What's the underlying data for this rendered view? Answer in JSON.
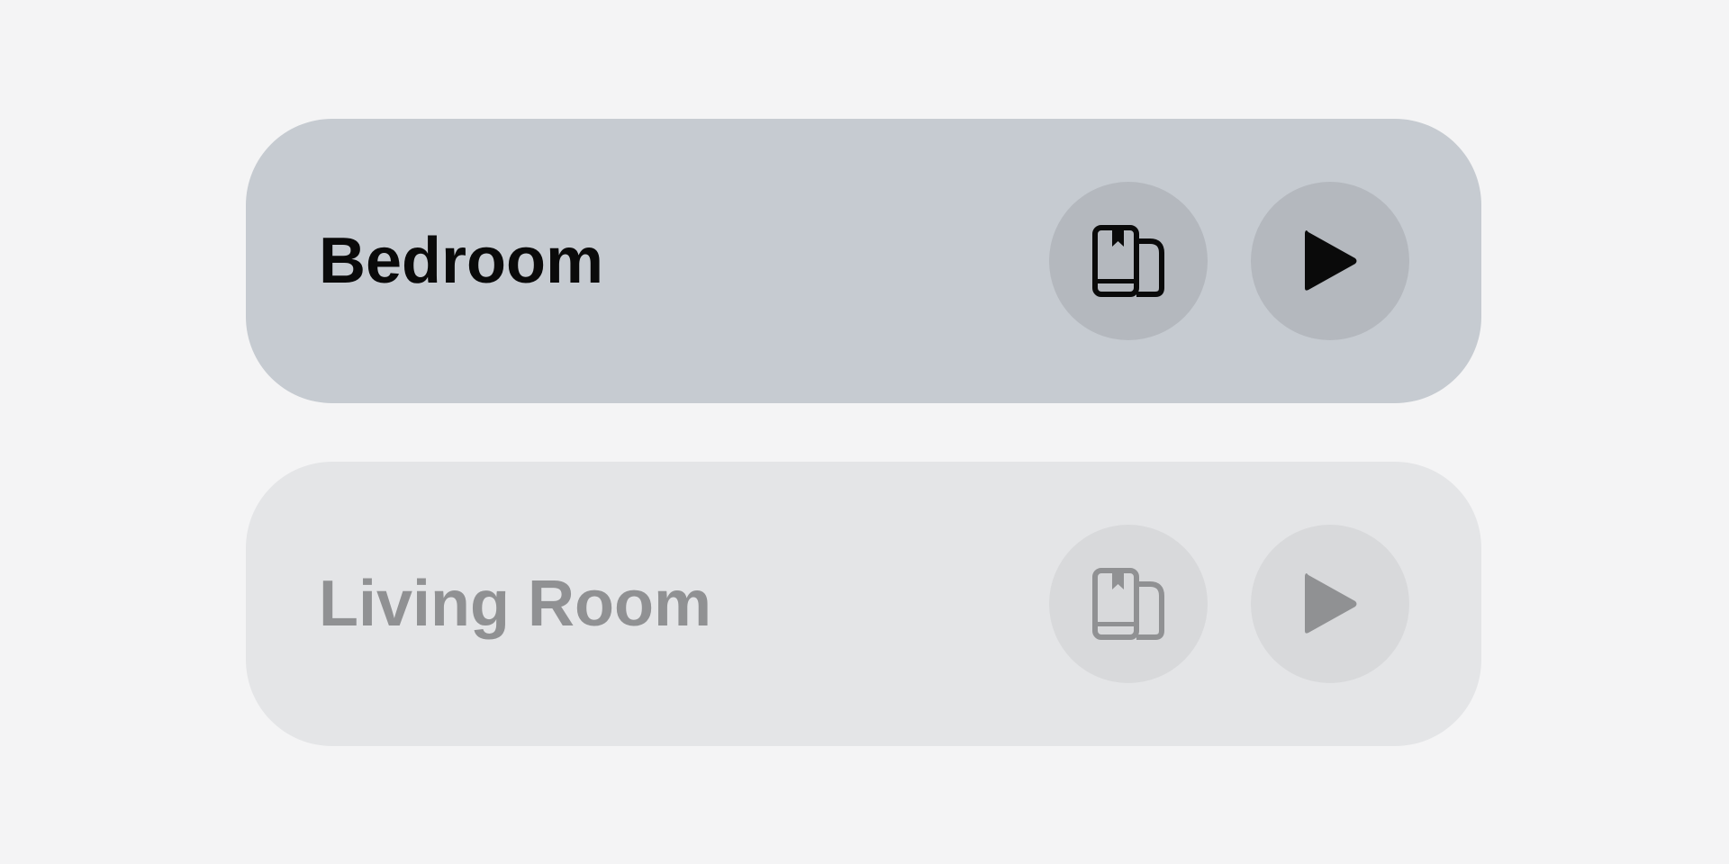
{
  "rooms": [
    {
      "name": "Bedroom",
      "state": "active",
      "actions": [
        {
          "icon": "library-icon"
        },
        {
          "icon": "play-icon"
        }
      ]
    },
    {
      "name": "Living Room",
      "state": "inactive",
      "actions": [
        {
          "icon": "library-icon"
        },
        {
          "icon": "play-icon"
        }
      ]
    }
  ],
  "colors": {
    "background": "#f4f4f5",
    "active_card": "#c6cbd1",
    "active_button": "#b4b8be",
    "active_text": "#0a0a0a",
    "inactive_card": "#e4e5e7",
    "inactive_button": "#d8d9db",
    "inactive_text": "#909193"
  }
}
